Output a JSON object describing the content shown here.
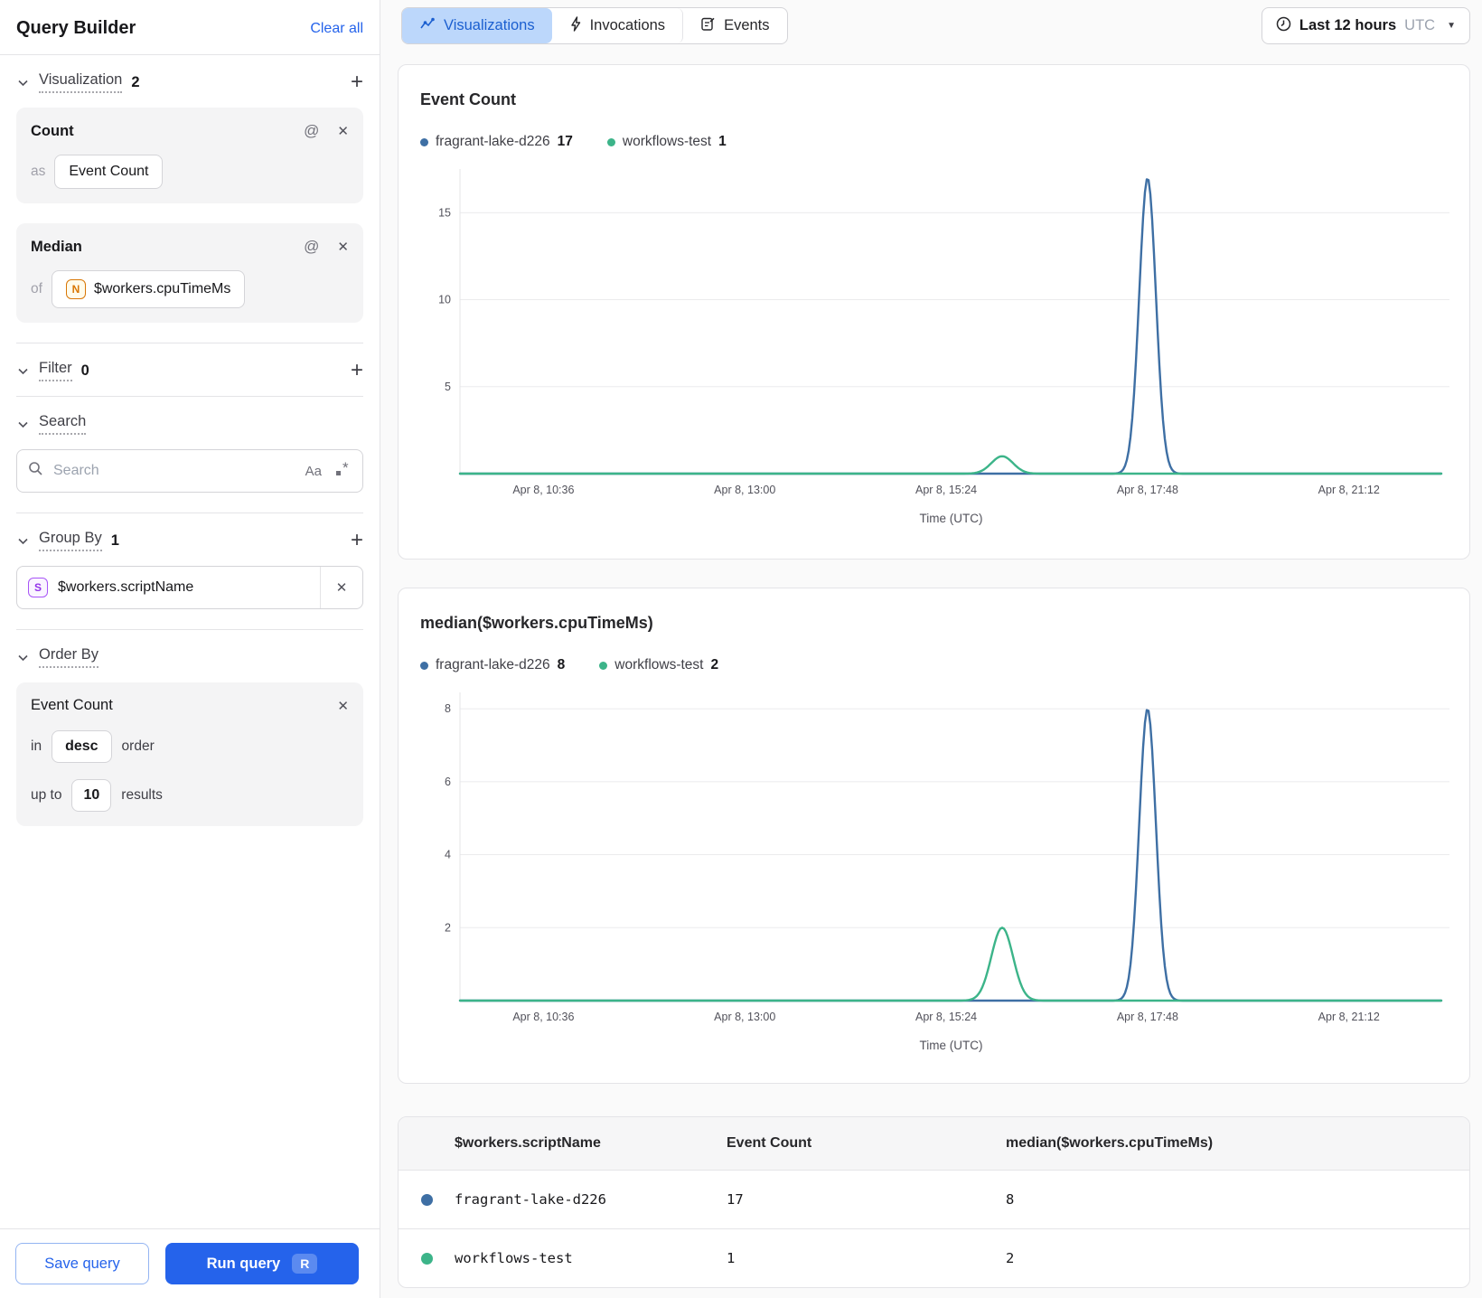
{
  "colors": {
    "accent": "#2563eb",
    "series_blue": "#3e6fa4",
    "series_green": "#3cb489",
    "tab_selected_bg": "#bcd7fb"
  },
  "sidebar": {
    "title": "Query Builder",
    "clear_all": "Clear all",
    "visualization": {
      "label": "Visualization",
      "count": "2"
    },
    "count_card": {
      "title": "Count",
      "as_label": "as",
      "alias": "Event Count"
    },
    "median_card": {
      "title": "Median",
      "of_label": "of",
      "field_icon_letter": "N",
      "field": "$workers.cpuTimeMs"
    },
    "filter": {
      "label": "Filter",
      "count": "0"
    },
    "search": {
      "label": "Search",
      "placeholder": "Search",
      "case_sensitivity_icon": "Aa"
    },
    "group_by": {
      "label": "Group By",
      "count": "1",
      "item": {
        "icon_letter": "S",
        "field": "$workers.scriptName"
      }
    },
    "order_by": {
      "label": "Order By",
      "card": {
        "field": "Event Count",
        "in_label": "in",
        "direction": "desc",
        "order_label": "order",
        "up_to_label": "up to",
        "limit": "10",
        "results_label": "results"
      }
    },
    "footer": {
      "save_label": "Save query",
      "run_label": "Run query",
      "run_shortcut": "R"
    }
  },
  "topbar": {
    "tabs": [
      {
        "label": "Visualizations"
      },
      {
        "label": "Invocations"
      },
      {
        "label": "Events"
      }
    ],
    "time_range": {
      "label": "Last 12 hours",
      "timezone": "UTC"
    }
  },
  "chart_data": [
    {
      "type": "line",
      "title": "Event Count",
      "legend": [
        {
          "name": "fragrant-lake-d226",
          "value": "17"
        },
        {
          "name": "workflows-test",
          "value": "1"
        }
      ],
      "ylim": [
        0,
        17.2
      ],
      "y_ticks": [
        5,
        10,
        15
      ],
      "x_ticks": [
        {
          "label": "Apr 8, 10:36",
          "frac": 0.085
        },
        {
          "label": "Apr 8, 13:00",
          "frac": 0.29
        },
        {
          "label": "Apr 8, 15:24",
          "frac": 0.495
        },
        {
          "label": "Apr 8, 17:48",
          "frac": 0.7
        },
        {
          "label": "Apr 8, 21:12",
          "frac": 0.905
        }
      ],
      "xlabel": "Time (UTC)",
      "grid": true,
      "legend_position": "top",
      "series": [
        {
          "name": "fragrant-lake-d226",
          "color": "#3e6fa4",
          "baseline": 0,
          "peaks": [
            {
              "frac": 0.7,
              "value": 17,
              "sigma": 0.0085
            }
          ]
        },
        {
          "name": "workflows-test",
          "color": "#3cb489",
          "baseline": 0,
          "peaks": [
            {
              "frac": 0.552,
              "value": 1,
              "sigma": 0.011
            }
          ]
        }
      ]
    },
    {
      "type": "line",
      "title": "median($workers.cpuTimeMs)",
      "legend": [
        {
          "name": "fragrant-lake-d226",
          "value": "8"
        },
        {
          "name": "workflows-test",
          "value": "2"
        }
      ],
      "ylim": [
        0,
        8.3
      ],
      "y_ticks": [
        2,
        4,
        6,
        8
      ],
      "x_ticks": [
        {
          "label": "Apr 8, 10:36",
          "frac": 0.085
        },
        {
          "label": "Apr 8, 13:00",
          "frac": 0.29
        },
        {
          "label": "Apr 8, 15:24",
          "frac": 0.495
        },
        {
          "label": "Apr 8, 17:48",
          "frac": 0.7
        },
        {
          "label": "Apr 8, 21:12",
          "frac": 0.905
        }
      ],
      "xlabel": "Time (UTC)",
      "grid": true,
      "legend_position": "top",
      "series": [
        {
          "name": "fragrant-lake-d226",
          "color": "#3e6fa4",
          "baseline": 0,
          "peaks": [
            {
              "frac": 0.7,
              "value": 8,
              "sigma": 0.0085
            }
          ]
        },
        {
          "name": "workflows-test",
          "color": "#3cb489",
          "baseline": 0,
          "peaks": [
            {
              "frac": 0.552,
              "value": 2,
              "sigma": 0.011
            }
          ]
        }
      ]
    }
  ],
  "results_table": {
    "columns": [
      "$workers.scriptName",
      "Event Count",
      "median($workers.cpuTimeMs)"
    ],
    "rows": [
      {
        "dot_color": "#3e6fa4",
        "script_name": "fragrant-lake-d226",
        "event_count": "17",
        "median": "8"
      },
      {
        "dot_color": "#3cb489",
        "script_name": "workflows-test",
        "event_count": "1",
        "median": "2"
      }
    ]
  }
}
